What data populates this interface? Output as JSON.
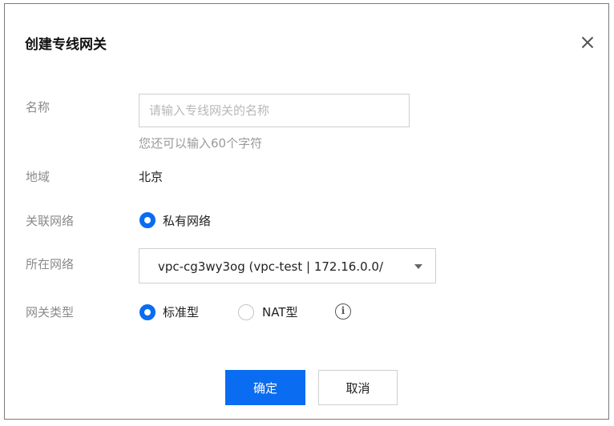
{
  "dialog": {
    "title": "创建专线网关"
  },
  "form": {
    "name": {
      "label": "名称",
      "placeholder": "请输入专线网关的名称",
      "value": "",
      "hint": "您还可以输入60个字符"
    },
    "region": {
      "label": "地域",
      "value": "北京"
    },
    "network_type": {
      "label": "关联网络",
      "options": [
        {
          "label": "私有网络",
          "selected": true
        }
      ]
    },
    "network": {
      "label": "所在网络",
      "selected": "vpc-cg3wy3og (vpc-test | 172.16.0.0/"
    },
    "gateway_type": {
      "label": "网关类型",
      "options": [
        {
          "label": "标准型",
          "selected": true
        },
        {
          "label": "NAT型",
          "selected": false
        }
      ]
    }
  },
  "buttons": {
    "confirm": "确定",
    "cancel": "取消"
  },
  "colors": {
    "primary": "#0a6cf0",
    "label": "#8a8a8a",
    "border": "#cfcfcf"
  }
}
